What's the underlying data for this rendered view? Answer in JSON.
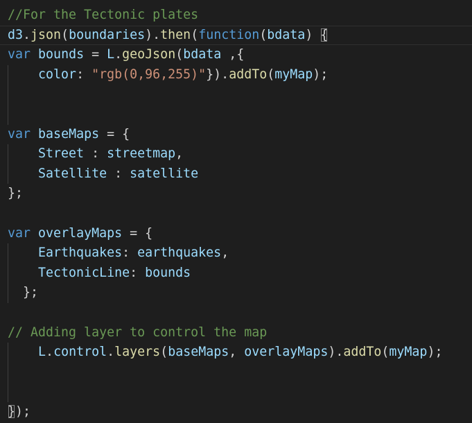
{
  "editor": {
    "theme": {
      "background": "#1e1e1e",
      "comment": "#6a9955",
      "keyword": "#569cd6",
      "variable": "#9cdcfe",
      "function": "#dcdcaa",
      "string": "#ce9178",
      "punctuation": "#d4d4d4"
    },
    "lines": [
      {
        "guide": false,
        "tokens": [
          {
            "t": "comment",
            "v": "//For the Tectonic plates"
          }
        ]
      },
      {
        "guide": false,
        "current": true,
        "tokens": [
          {
            "t": "var",
            "v": "d3"
          },
          {
            "t": "punc",
            "v": "."
          },
          {
            "t": "func",
            "v": "json"
          },
          {
            "t": "punc",
            "v": "("
          },
          {
            "t": "var",
            "v": "boundaries"
          },
          {
            "t": "punc",
            "v": ")."
          },
          {
            "t": "func",
            "v": "then"
          },
          {
            "t": "punc",
            "v": "("
          },
          {
            "t": "keyword",
            "v": "function"
          },
          {
            "t": "punc",
            "v": "("
          },
          {
            "t": "var",
            "v": "bdata"
          },
          {
            "t": "punc",
            "v": ") "
          },
          {
            "t": "punc",
            "v": "{",
            "hl": true
          }
        ]
      },
      {
        "guide": false,
        "tokens": [
          {
            "t": "keyword",
            "v": "var"
          },
          {
            "t": "punc",
            "v": " "
          },
          {
            "t": "var",
            "v": "bounds"
          },
          {
            "t": "punc",
            "v": " = "
          },
          {
            "t": "var",
            "v": "L"
          },
          {
            "t": "punc",
            "v": "."
          },
          {
            "t": "func",
            "v": "geoJson"
          },
          {
            "t": "punc",
            "v": "("
          },
          {
            "t": "var",
            "v": "bdata"
          },
          {
            "t": "punc",
            "v": " ,{"
          }
        ]
      },
      {
        "guide": true,
        "tokens": [
          {
            "t": "punc",
            "v": "    "
          },
          {
            "t": "var",
            "v": "color"
          },
          {
            "t": "punc",
            "v": ": "
          },
          {
            "t": "string",
            "v": "\"rgb(0,96,255)\""
          },
          {
            "t": "punc",
            "v": "})."
          },
          {
            "t": "func",
            "v": "addTo"
          },
          {
            "t": "punc",
            "v": "("
          },
          {
            "t": "var",
            "v": "myMap"
          },
          {
            "t": "punc",
            "v": ");"
          }
        ]
      },
      {
        "guide": true,
        "tokens": []
      },
      {
        "guide": true,
        "tokens": []
      },
      {
        "guide": false,
        "tokens": [
          {
            "t": "keyword",
            "v": "var"
          },
          {
            "t": "punc",
            "v": " "
          },
          {
            "t": "var",
            "v": "baseMaps"
          },
          {
            "t": "punc",
            "v": " = {"
          }
        ]
      },
      {
        "guide": true,
        "tokens": [
          {
            "t": "punc",
            "v": "    "
          },
          {
            "t": "var",
            "v": "Street"
          },
          {
            "t": "punc",
            "v": " : "
          },
          {
            "t": "var",
            "v": "streetmap"
          },
          {
            "t": "punc",
            "v": ","
          }
        ]
      },
      {
        "guide": true,
        "tokens": [
          {
            "t": "punc",
            "v": "    "
          },
          {
            "t": "var",
            "v": "Satellite"
          },
          {
            "t": "punc",
            "v": " : "
          },
          {
            "t": "var",
            "v": "satellite"
          }
        ]
      },
      {
        "guide": false,
        "tokens": [
          {
            "t": "punc",
            "v": "};"
          }
        ]
      },
      {
        "guide": false,
        "tokens": []
      },
      {
        "guide": false,
        "tokens": [
          {
            "t": "keyword",
            "v": "var"
          },
          {
            "t": "punc",
            "v": " "
          },
          {
            "t": "var",
            "v": "overlayMaps"
          },
          {
            "t": "punc",
            "v": " = {"
          }
        ]
      },
      {
        "guide": true,
        "tokens": [
          {
            "t": "punc",
            "v": "    "
          },
          {
            "t": "var",
            "v": "Earthquakes"
          },
          {
            "t": "punc",
            "v": ": "
          },
          {
            "t": "var",
            "v": "earthquakes"
          },
          {
            "t": "punc",
            "v": ","
          }
        ]
      },
      {
        "guide": true,
        "tokens": [
          {
            "t": "punc",
            "v": "    "
          },
          {
            "t": "var",
            "v": "TectonicLine"
          },
          {
            "t": "punc",
            "v": ": "
          },
          {
            "t": "var",
            "v": "bounds"
          }
        ]
      },
      {
        "guide": true,
        "tokens": [
          {
            "t": "punc",
            "v": "  };"
          }
        ]
      },
      {
        "guide": false,
        "tokens": []
      },
      {
        "guide": false,
        "tokens": [
          {
            "t": "comment",
            "v": "// Adding layer to control the map"
          }
        ]
      },
      {
        "guide": true,
        "tokens": [
          {
            "t": "punc",
            "v": "    "
          },
          {
            "t": "var",
            "v": "L"
          },
          {
            "t": "punc",
            "v": "."
          },
          {
            "t": "var",
            "v": "control"
          },
          {
            "t": "punc",
            "v": "."
          },
          {
            "t": "func",
            "v": "layers"
          },
          {
            "t": "punc",
            "v": "("
          },
          {
            "t": "var",
            "v": "baseMaps"
          },
          {
            "t": "punc",
            "v": ", "
          },
          {
            "t": "var",
            "v": "overlayMaps"
          },
          {
            "t": "punc",
            "v": ")."
          },
          {
            "t": "func",
            "v": "addTo"
          },
          {
            "t": "punc",
            "v": "("
          },
          {
            "t": "var",
            "v": "myMap"
          },
          {
            "t": "punc",
            "v": ");"
          }
        ]
      },
      {
        "guide": true,
        "tokens": []
      },
      {
        "guide": true,
        "tokens": []
      },
      {
        "guide": false,
        "tokens": [
          {
            "t": "punc",
            "v": "}",
            "hl": true
          },
          {
            "t": "punc",
            "v": ");"
          }
        ]
      }
    ]
  }
}
